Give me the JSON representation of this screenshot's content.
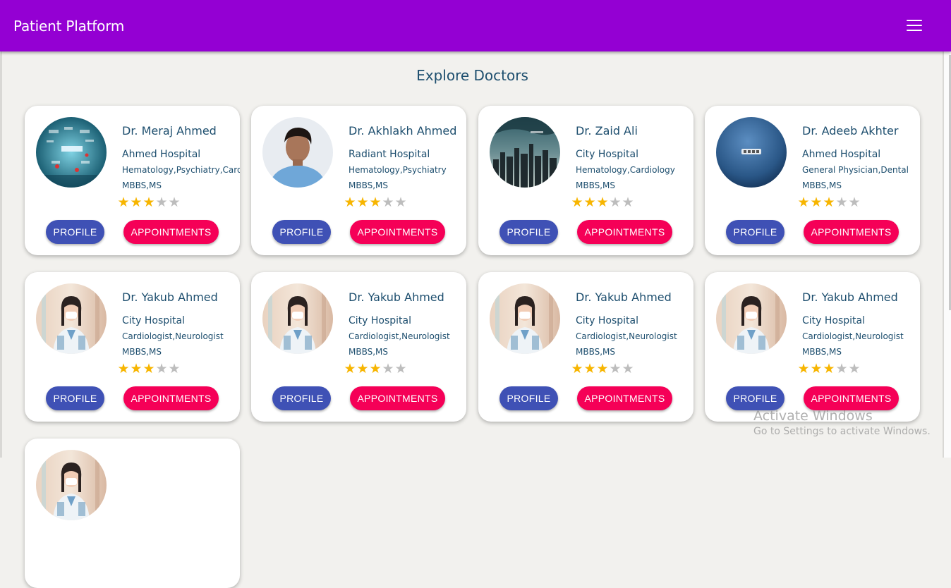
{
  "app": {
    "title": "Patient Platform",
    "menu_icon": "hamburger-icon"
  },
  "page": {
    "heading": "Explore Doctors"
  },
  "actions": {
    "profile_label": "PROFILE",
    "appointments_label": "APPOINTMENTS"
  },
  "colors": {
    "appbar": "#9400d3",
    "profile_button": "#3f51b5",
    "appointments_button": "#f50057",
    "star_filled": "#f7b500",
    "star_empty": "#bdbdbd",
    "text": "#1d4e6e"
  },
  "doctors": [
    {
      "name": "Dr. Meraj Ahmed",
      "hospital": "Ahmed Hospital",
      "specialties": "Hematology,Psychiatry,Cardiology",
      "degree": "MBBS,MS",
      "rating": 3,
      "max_rating": 5,
      "photo": "success-collage"
    },
    {
      "name": "Dr. Akhlakh Ahmed",
      "hospital": "Radiant Hospital",
      "specialties": "Hematology,Psychiatry",
      "degree": "MBBS,MS",
      "rating": 3,
      "max_rating": 5,
      "photo": "man-portrait"
    },
    {
      "name": "Dr. Zaid Ali",
      "hospital": "City Hospital",
      "specialties": "Hematology,Cardiology",
      "degree": "MBBS,MS",
      "rating": 3,
      "max_rating": 5,
      "photo": "city-storm"
    },
    {
      "name": "Dr. Adeeb Akhter",
      "hospital": "Ahmed Hospital",
      "specialties": "General Physician,Dental",
      "degree": "MBBS,MS",
      "rating": 3,
      "max_rating": 5,
      "photo": "blue-sphere"
    },
    {
      "name": "Dr. Yakub Ahmed",
      "hospital": "City Hospital",
      "specialties": "Cardiologist,Neurologist",
      "degree": "MBBS,MS",
      "rating": 3,
      "max_rating": 5,
      "photo": "nurse-portrait"
    },
    {
      "name": "Dr. Yakub Ahmed",
      "hospital": "City Hospital",
      "specialties": "Cardiologist,Neurologist",
      "degree": "MBBS,MS",
      "rating": 3,
      "max_rating": 5,
      "photo": "nurse-portrait"
    },
    {
      "name": "Dr. Yakub Ahmed",
      "hospital": "City Hospital",
      "specialties": "Cardiologist,Neurologist",
      "degree": "MBBS,MS",
      "rating": 3,
      "max_rating": 5,
      "photo": "nurse-portrait"
    },
    {
      "name": "Dr. Yakub Ahmed",
      "hospital": "City Hospital",
      "specialties": "Cardiologist,Neurologist",
      "degree": "MBBS,MS",
      "rating": 3,
      "max_rating": 5,
      "photo": "nurse-portrait"
    }
  ],
  "partial_card": {
    "photo": "nurse-portrait"
  },
  "os_watermark": {
    "line1": "Activate Windows",
    "line2": "Go to Settings to activate Windows."
  }
}
